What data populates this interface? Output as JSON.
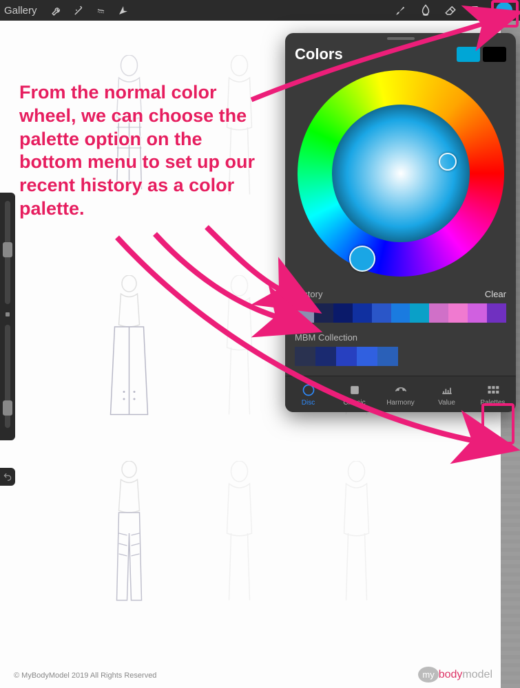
{
  "topbar": {
    "gallery_label": "Gallery",
    "left_icons": [
      "wrench-icon",
      "wand-icon",
      "s-icon",
      "arrow-icon"
    ],
    "right_icons": [
      "brush-icon",
      "smudge-icon",
      "eraser-icon",
      "layers-icon"
    ],
    "color_dot": "#1aa6e5"
  },
  "annotation_text": "From the normal color wheel, we can choose the palette option on the bottom menu to set up our recent history as a color palette.",
  "popover": {
    "title": "Colors",
    "current_color": "#00a6d6",
    "compare_color": "#000000",
    "history": {
      "label": "History",
      "clear_label": "Clear",
      "swatches": [
        "#8a90b0",
        "#1a2350",
        "#0a1a6a",
        "#1030a0",
        "#2a56c8",
        "#1a7be0",
        "#0aa0c8",
        "#d070c8",
        "#f07ad0",
        "#d060e0",
        "#7030c0"
      ]
    },
    "collection": {
      "label": "MBM Collection",
      "swatches": [
        "#2a3250",
        "#1a2a70",
        "#2740c0",
        "#3060e0",
        "#2a60b8"
      ]
    },
    "tabs": [
      {
        "id": "disc",
        "label": "Disc",
        "active": true
      },
      {
        "id": "classic",
        "label": "Classic",
        "active": false
      },
      {
        "id": "harmony",
        "label": "Harmony",
        "active": false
      },
      {
        "id": "value",
        "label": "Value",
        "active": false
      },
      {
        "id": "palettes",
        "label": "Palettes",
        "active": false
      }
    ]
  },
  "canvas": {
    "copyright": "© MyBodyModel 2019 All Rights Reserved",
    "logo_parts": {
      "my": "my",
      "body": "body",
      "model": "model"
    }
  },
  "accent": "#ec1e79"
}
